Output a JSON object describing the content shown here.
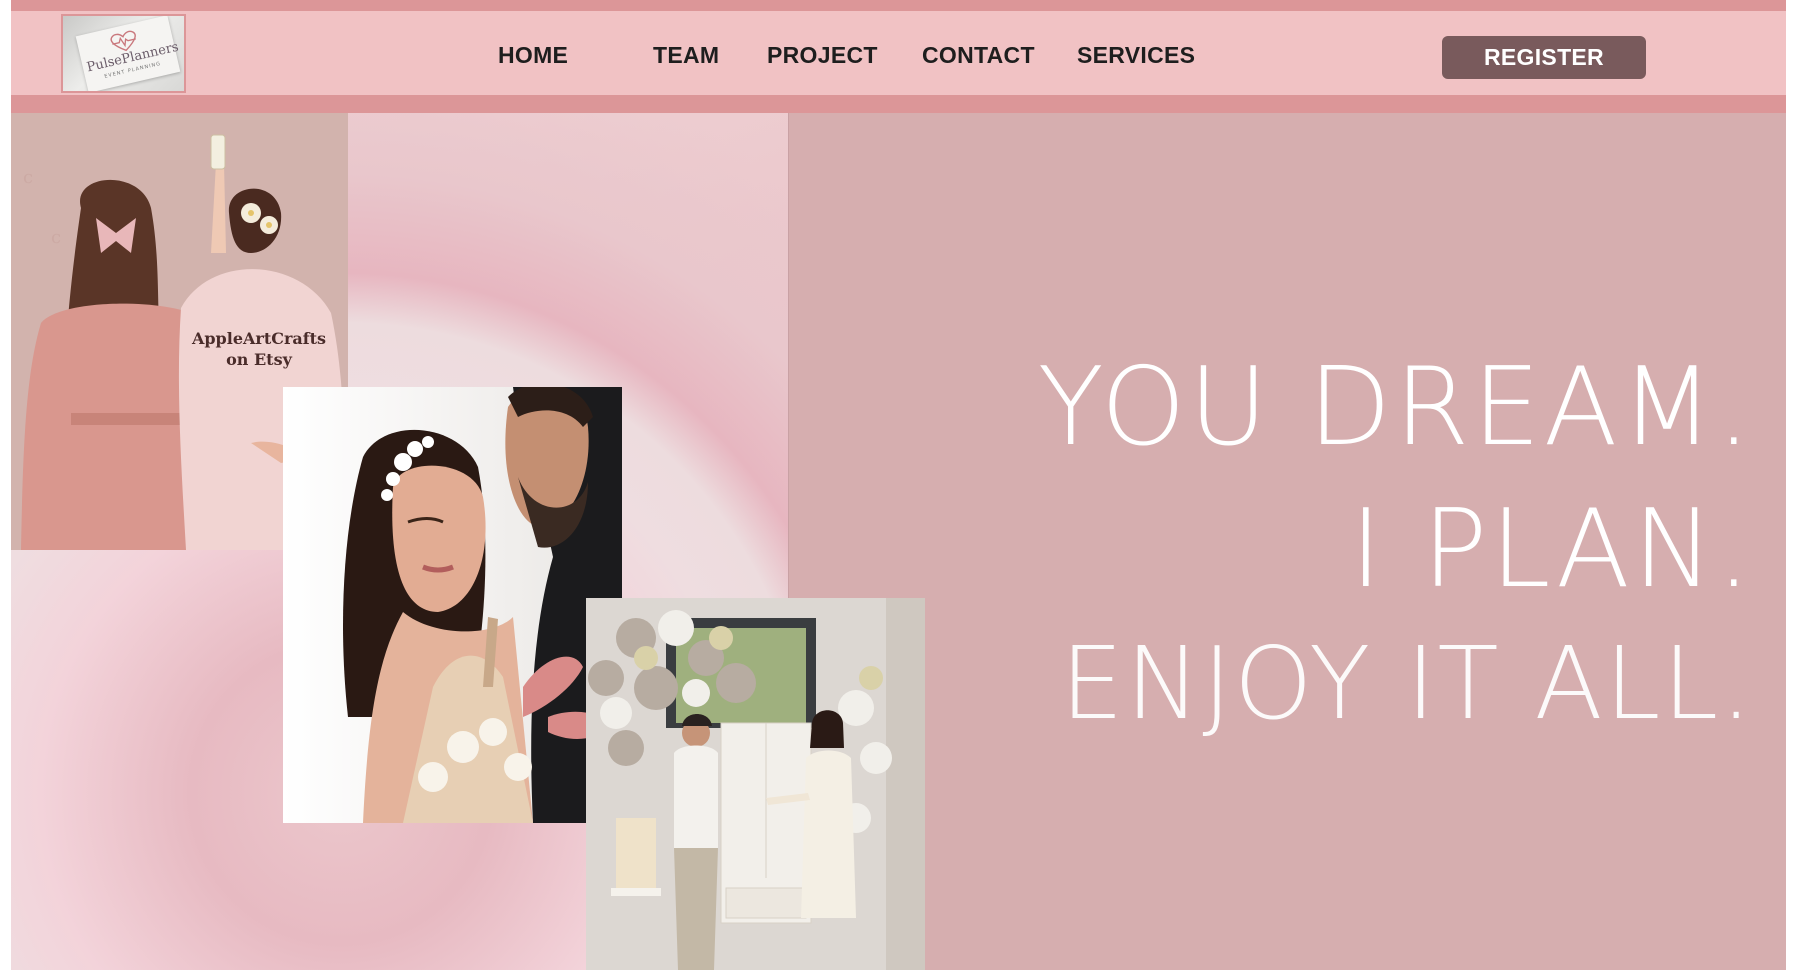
{
  "logo": {
    "name": "PulsePlanners",
    "tagline": "EVENT PLANNING"
  },
  "nav": {
    "items": [
      {
        "label": "HOME"
      },
      {
        "label": "TEAM"
      },
      {
        "label": "PROJECT"
      },
      {
        "label": "CONTACT"
      },
      {
        "label": "SERVICES"
      }
    ],
    "register_label": "REGISTER"
  },
  "hero": {
    "slogan": [
      "YOU DREAM.",
      "I PLAN.",
      "ENJOY IT ALL."
    ],
    "images": {
      "robes_watermark": [
        "AppleArtCrafts",
        "on Etsy"
      ]
    }
  },
  "colors": {
    "top_stripe": "#dc9698",
    "navbar": "#f1c2c4",
    "register_button": "#795a5c",
    "hero_right": "#d6aeaf",
    "slogan_text": "#ffffff"
  }
}
